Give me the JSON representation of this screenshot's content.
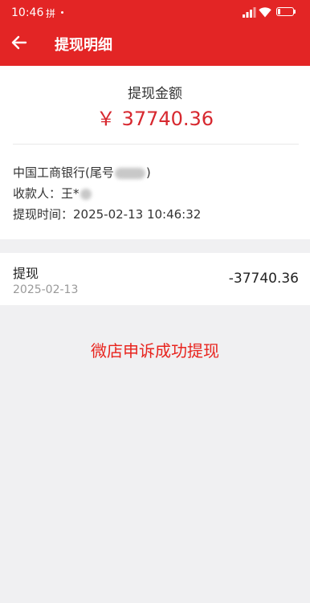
{
  "status_bar": {
    "time": "10:46",
    "notification_glyph": "拼",
    "battery": "17"
  },
  "header": {
    "title": "提现明细",
    "accent_color": "#e32525"
  },
  "summary": {
    "amount_label": "提现金额",
    "amount_value": "￥ 37740.36",
    "amount_color": "#d7282f",
    "bank_prefix": "中国工商银行(尾号",
    "bank_suffix": ")",
    "payee_prefix": "收款人：王*",
    "withdraw_time": "提现时间：2025-02-13 10:46:32"
  },
  "transaction": {
    "title": "提现",
    "date": "2025-02-13",
    "amount": "-37740.36"
  },
  "caption": {
    "text": "微店申诉成功提现",
    "color": "#e8241e"
  }
}
